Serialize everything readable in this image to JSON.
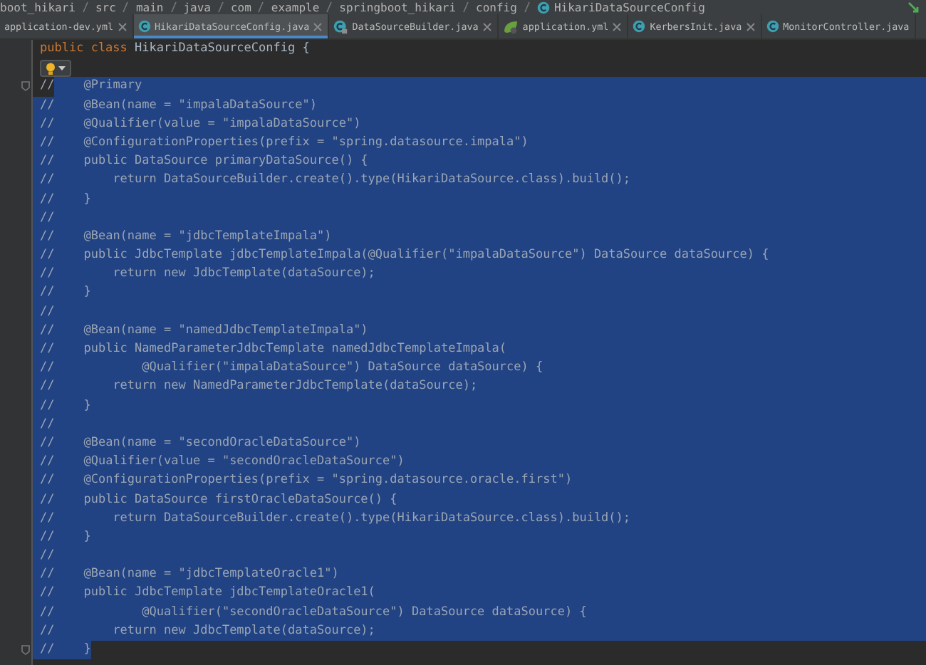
{
  "breadcrumb": {
    "items": [
      {
        "label": "boot_hikari"
      },
      {
        "label": "src"
      },
      {
        "label": "main"
      },
      {
        "label": "java"
      },
      {
        "label": "com"
      },
      {
        "label": "example"
      },
      {
        "label": "springboot_hikari"
      },
      {
        "label": "config"
      },
      {
        "label": "HikariDataSourceConfig"
      }
    ]
  },
  "tabs": [
    {
      "label": "application-dev.yml",
      "kind": "plain",
      "selected": false
    },
    {
      "label": "HikariDataSourceConfig.java",
      "kind": "class",
      "selected": true
    },
    {
      "label": "DataSourceBuilder.java",
      "kind": "locked",
      "selected": false
    },
    {
      "label": "application.yml",
      "kind": "spring",
      "selected": false
    },
    {
      "label": "KerbersInit.java",
      "kind": "class",
      "selected": false
    },
    {
      "label": "MonitorController.java",
      "kind": "class",
      "selected": false
    }
  ],
  "editor": {
    "lines": [
      {
        "kind": "declaration",
        "tokens": [
          {
            "text": "public class",
            "kind": "keyword"
          },
          {
            "text": " HikariDataSourceConfig {",
            "kind": "plain"
          }
        ]
      },
      {
        "kind": "intention"
      },
      {
        "kind": "comment",
        "marker": "//",
        "code": "    @Primary",
        "marker_selected": false,
        "selected": true
      },
      {
        "kind": "comment",
        "marker": "//",
        "code": "    @Bean(name = \"impalaDataSource\")",
        "marker_selected": true,
        "selected": true
      },
      {
        "kind": "comment",
        "marker": "//",
        "code": "    @Qualifier(value = \"impalaDataSource\")",
        "marker_selected": true,
        "selected": true
      },
      {
        "kind": "comment",
        "marker": "//",
        "code": "    @ConfigurationProperties(prefix = \"spring.datasource.impala\")",
        "marker_selected": true,
        "selected": true
      },
      {
        "kind": "comment",
        "marker": "//",
        "code": "    public DataSource primaryDataSource() {",
        "marker_selected": true,
        "selected": true
      },
      {
        "kind": "comment",
        "marker": "//",
        "code": "        return DataSourceBuilder.create().type(HikariDataSource.class).build();",
        "marker_selected": true,
        "selected": true
      },
      {
        "kind": "comment",
        "marker": "//",
        "code": "    }",
        "marker_selected": true,
        "selected": true
      },
      {
        "kind": "comment",
        "marker": "//",
        "marker_selected": true,
        "selected": true
      },
      {
        "kind": "comment",
        "marker": "//",
        "code": "    @Bean(name = \"jdbcTemplateImpala\")",
        "marker_selected": true,
        "selected": true
      },
      {
        "kind": "comment",
        "marker": "//",
        "code": "    public JdbcTemplate jdbcTemplateImpala(@Qualifier(\"impalaDataSource\") DataSource dataSource) {",
        "marker_selected": true,
        "selected": true
      },
      {
        "kind": "comment",
        "marker": "//",
        "code": "        return new JdbcTemplate(dataSource);",
        "marker_selected": true,
        "selected": true
      },
      {
        "kind": "comment",
        "marker": "//",
        "code": "    }",
        "marker_selected": true,
        "selected": true
      },
      {
        "kind": "comment",
        "marker": "//",
        "marker_selected": true,
        "selected": true
      },
      {
        "kind": "comment",
        "marker": "//",
        "code": "    @Bean(name = \"namedJdbcTemplateImpala\")",
        "marker_selected": true,
        "selected": true
      },
      {
        "kind": "comment",
        "marker": "//",
        "code": "    public NamedParameterJdbcTemplate namedJdbcTemplateImpala(",
        "marker_selected": true,
        "selected": true
      },
      {
        "kind": "comment",
        "marker": "//",
        "code": "            @Qualifier(\"impalaDataSource\") DataSource dataSource) {",
        "marker_selected": true,
        "selected": true
      },
      {
        "kind": "comment",
        "marker": "//",
        "code": "        return new NamedParameterJdbcTemplate(dataSource);",
        "marker_selected": true,
        "selected": true
      },
      {
        "kind": "comment",
        "marker": "//",
        "code": "    }",
        "marker_selected": true,
        "selected": true
      },
      {
        "kind": "comment",
        "marker": "//",
        "marker_selected": true,
        "selected": true
      },
      {
        "kind": "comment",
        "marker": "//",
        "code": "    @Bean(name = \"secondOracleDataSource\")",
        "marker_selected": true,
        "selected": true
      },
      {
        "kind": "comment",
        "marker": "//",
        "code": "    @Qualifier(value = \"secondOracleDataSource\")",
        "marker_selected": true,
        "selected": true
      },
      {
        "kind": "comment",
        "marker": "//",
        "code": "    @ConfigurationProperties(prefix = \"spring.datasource.oracle.first\")",
        "marker_selected": true,
        "selected": true
      },
      {
        "kind": "comment",
        "marker": "//",
        "code": "    public DataSource firstOracleDataSource() {",
        "marker_selected": true,
        "selected": true
      },
      {
        "kind": "comment",
        "marker": "//",
        "code": "        return DataSourceBuilder.create().type(HikariDataSource.class).build();",
        "marker_selected": true,
        "selected": true
      },
      {
        "kind": "comment",
        "marker": "//",
        "code": "    }",
        "marker_selected": true,
        "selected": true
      },
      {
        "kind": "comment",
        "marker": "//",
        "marker_selected": true,
        "selected": true
      },
      {
        "kind": "comment",
        "marker": "//",
        "code": "    @Bean(name = \"jdbcTemplateOracle1\")",
        "marker_selected": true,
        "selected": true
      },
      {
        "kind": "comment",
        "marker": "//",
        "code": "    public JdbcTemplate jdbcTemplateOracle1(",
        "marker_selected": true,
        "selected": true
      },
      {
        "kind": "comment",
        "marker": "//",
        "code": "            @Qualifier(\"secondOracleDataSource\") DataSource dataSource) {",
        "marker_selected": true,
        "selected": true
      },
      {
        "kind": "comment",
        "marker": "//",
        "code": "        return new JdbcTemplate(dataSource);",
        "marker_selected": true,
        "selected": true
      },
      {
        "kind": "comment",
        "marker": "//",
        "code": "    }",
        "marker_selected": true,
        "selected": true
      }
    ]
  }
}
